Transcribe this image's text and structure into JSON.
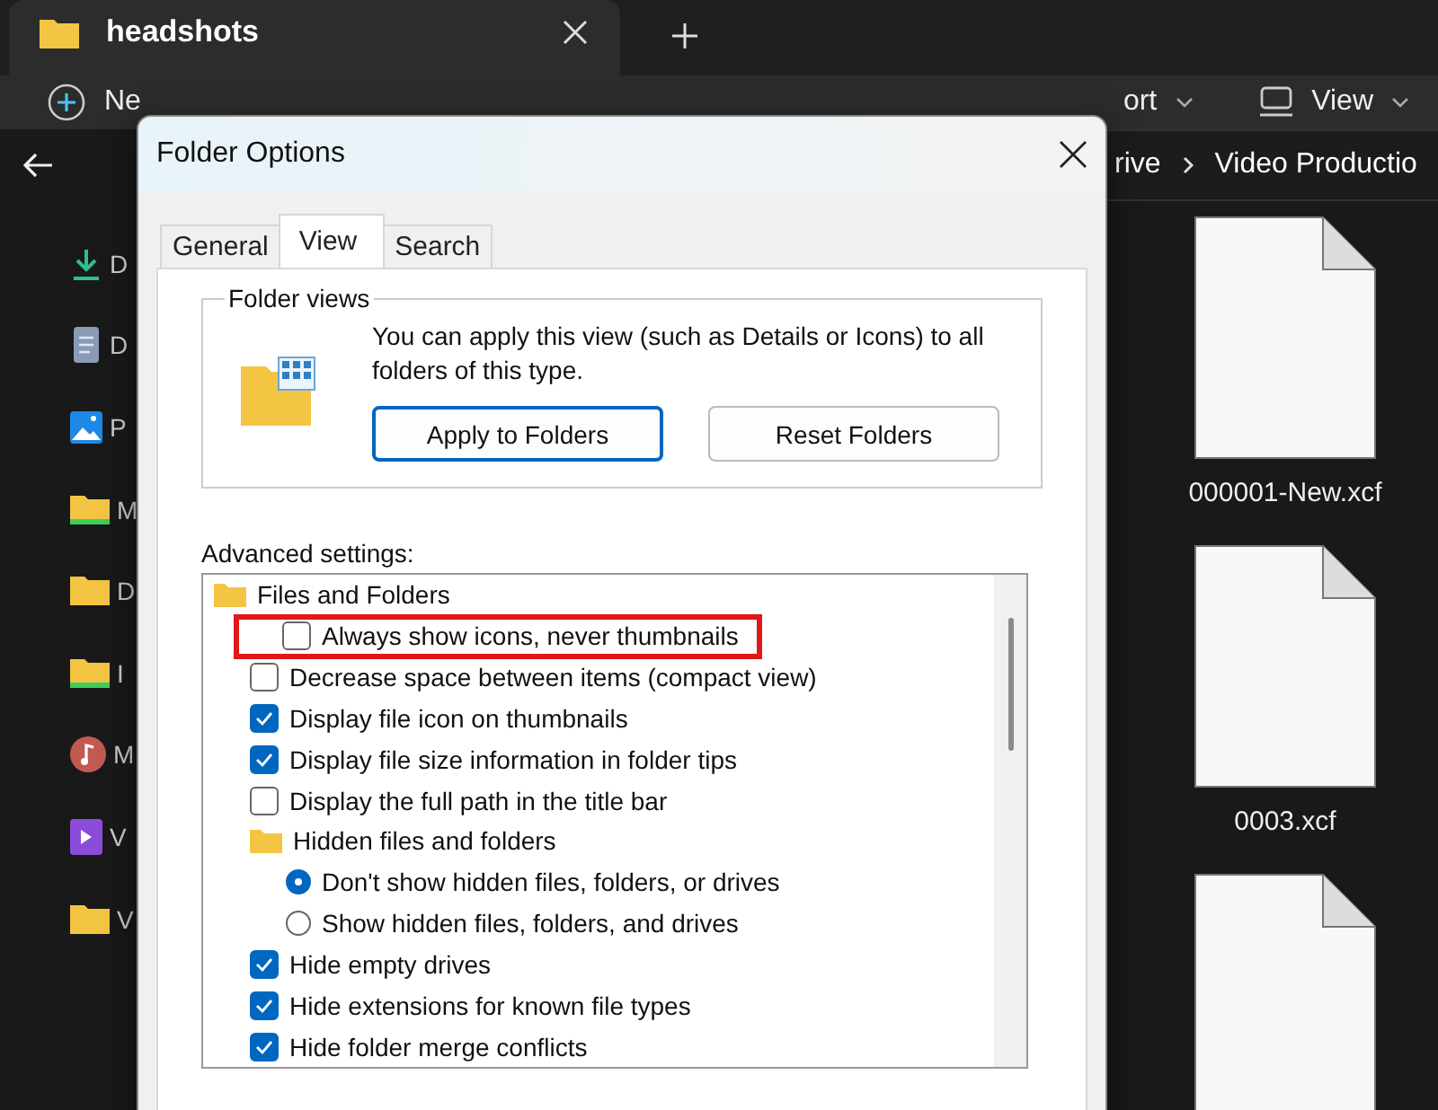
{
  "explorer": {
    "tab": {
      "title": "headshots"
    },
    "toolbar": {
      "new_button": "Ne",
      "sort_button": "ort",
      "view_button": "View"
    },
    "breadcrumb": [
      "rive",
      "Video Productio"
    ],
    "sidebar": {
      "items": [
        {
          "label": "D"
        },
        {
          "label": "D"
        },
        {
          "label": "P"
        },
        {
          "label": "M"
        },
        {
          "label": "D"
        },
        {
          "label": "I"
        },
        {
          "label": "M"
        },
        {
          "label": "V"
        },
        {
          "label": "V"
        }
      ]
    },
    "files": [
      {
        "name": "000001-New.xcf"
      },
      {
        "name": "0003.xcf"
      }
    ]
  },
  "dialog": {
    "title": "Folder Options",
    "tabs": [
      {
        "label": "General",
        "selected": false
      },
      {
        "label": "View",
        "selected": true
      },
      {
        "label": "Search",
        "selected": false
      }
    ],
    "folder_views": {
      "title": "Folder views",
      "text": "You can apply this view (such as Details or Icons) to all folders of this type.",
      "buttons": [
        {
          "label": "Apply to Folders",
          "focused": true
        },
        {
          "label": "Reset Folders",
          "focused": false
        }
      ]
    },
    "advanced_settings": {
      "label": "Advanced settings:",
      "tree": [
        {
          "kind": "folder",
          "label": "Files and Folders",
          "highlighted": false,
          "children": [
            {
              "kind": "checkbox",
              "label": "Always show icons, never thumbnails",
              "checked": false,
              "highlighted": true
            },
            {
              "kind": "checkbox",
              "label": "Decrease space between items (compact view)",
              "checked": false,
              "highlighted": false
            },
            {
              "kind": "checkbox",
              "label": "Display file icon on thumbnails",
              "checked": true,
              "highlighted": false
            },
            {
              "kind": "checkbox",
              "label": "Display file size information in folder tips",
              "checked": true,
              "highlighted": false
            },
            {
              "kind": "checkbox",
              "label": "Display the full path in the title bar",
              "checked": false,
              "highlighted": false
            },
            {
              "kind": "folder",
              "label": "Hidden files and folders",
              "highlighted": false,
              "children": [
                {
                  "kind": "radio",
                  "label": "Don't show hidden files, folders, or drives",
                  "selected": true,
                  "highlighted": false
                },
                {
                  "kind": "radio",
                  "label": "Show hidden files, folders, and drives",
                  "selected": false,
                  "highlighted": false
                }
              ]
            },
            {
              "kind": "checkbox",
              "label": "Hide empty drives",
              "checked": true,
              "highlighted": false
            },
            {
              "kind": "checkbox",
              "label": "Hide extensions for known file types",
              "checked": true,
              "highlighted": false
            },
            {
              "kind": "checkbox",
              "label": "Hide folder merge conflicts",
              "checked": true,
              "highlighted": false
            }
          ]
        }
      ]
    }
  }
}
